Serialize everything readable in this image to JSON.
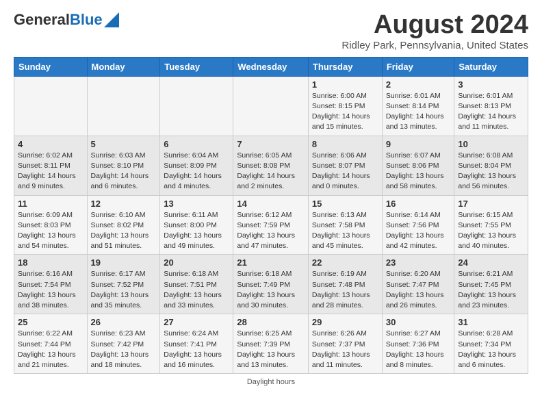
{
  "header": {
    "logo_line1": "General",
    "logo_line2": "Blue",
    "main_title": "August 2024",
    "sub_title": "Ridley Park, Pennsylvania, United States"
  },
  "days_of_week": [
    "Sunday",
    "Monday",
    "Tuesday",
    "Wednesday",
    "Thursday",
    "Friday",
    "Saturday"
  ],
  "weeks": [
    [
      {
        "day": "",
        "info": ""
      },
      {
        "day": "",
        "info": ""
      },
      {
        "day": "",
        "info": ""
      },
      {
        "day": "",
        "info": ""
      },
      {
        "day": "1",
        "info": "Sunrise: 6:00 AM\nSunset: 8:15 PM\nDaylight: 14 hours\nand 15 minutes."
      },
      {
        "day": "2",
        "info": "Sunrise: 6:01 AM\nSunset: 8:14 PM\nDaylight: 14 hours\nand 13 minutes."
      },
      {
        "day": "3",
        "info": "Sunrise: 6:01 AM\nSunset: 8:13 PM\nDaylight: 14 hours\nand 11 minutes."
      }
    ],
    [
      {
        "day": "4",
        "info": "Sunrise: 6:02 AM\nSunset: 8:11 PM\nDaylight: 14 hours\nand 9 minutes."
      },
      {
        "day": "5",
        "info": "Sunrise: 6:03 AM\nSunset: 8:10 PM\nDaylight: 14 hours\nand 6 minutes."
      },
      {
        "day": "6",
        "info": "Sunrise: 6:04 AM\nSunset: 8:09 PM\nDaylight: 14 hours\nand 4 minutes."
      },
      {
        "day": "7",
        "info": "Sunrise: 6:05 AM\nSunset: 8:08 PM\nDaylight: 14 hours\nand 2 minutes."
      },
      {
        "day": "8",
        "info": "Sunrise: 6:06 AM\nSunset: 8:07 PM\nDaylight: 14 hours\nand 0 minutes."
      },
      {
        "day": "9",
        "info": "Sunrise: 6:07 AM\nSunset: 8:06 PM\nDaylight: 13 hours\nand 58 minutes."
      },
      {
        "day": "10",
        "info": "Sunrise: 6:08 AM\nSunset: 8:04 PM\nDaylight: 13 hours\nand 56 minutes."
      }
    ],
    [
      {
        "day": "11",
        "info": "Sunrise: 6:09 AM\nSunset: 8:03 PM\nDaylight: 13 hours\nand 54 minutes."
      },
      {
        "day": "12",
        "info": "Sunrise: 6:10 AM\nSunset: 8:02 PM\nDaylight: 13 hours\nand 51 minutes."
      },
      {
        "day": "13",
        "info": "Sunrise: 6:11 AM\nSunset: 8:00 PM\nDaylight: 13 hours\nand 49 minutes."
      },
      {
        "day": "14",
        "info": "Sunrise: 6:12 AM\nSunset: 7:59 PM\nDaylight: 13 hours\nand 47 minutes."
      },
      {
        "day": "15",
        "info": "Sunrise: 6:13 AM\nSunset: 7:58 PM\nDaylight: 13 hours\nand 45 minutes."
      },
      {
        "day": "16",
        "info": "Sunrise: 6:14 AM\nSunset: 7:56 PM\nDaylight: 13 hours\nand 42 minutes."
      },
      {
        "day": "17",
        "info": "Sunrise: 6:15 AM\nSunset: 7:55 PM\nDaylight: 13 hours\nand 40 minutes."
      }
    ],
    [
      {
        "day": "18",
        "info": "Sunrise: 6:16 AM\nSunset: 7:54 PM\nDaylight: 13 hours\nand 38 minutes."
      },
      {
        "day": "19",
        "info": "Sunrise: 6:17 AM\nSunset: 7:52 PM\nDaylight: 13 hours\nand 35 minutes."
      },
      {
        "day": "20",
        "info": "Sunrise: 6:18 AM\nSunset: 7:51 PM\nDaylight: 13 hours\nand 33 minutes."
      },
      {
        "day": "21",
        "info": "Sunrise: 6:18 AM\nSunset: 7:49 PM\nDaylight: 13 hours\nand 30 minutes."
      },
      {
        "day": "22",
        "info": "Sunrise: 6:19 AM\nSunset: 7:48 PM\nDaylight: 13 hours\nand 28 minutes."
      },
      {
        "day": "23",
        "info": "Sunrise: 6:20 AM\nSunset: 7:47 PM\nDaylight: 13 hours\nand 26 minutes."
      },
      {
        "day": "24",
        "info": "Sunrise: 6:21 AM\nSunset: 7:45 PM\nDaylight: 13 hours\nand 23 minutes."
      }
    ],
    [
      {
        "day": "25",
        "info": "Sunrise: 6:22 AM\nSunset: 7:44 PM\nDaylight: 13 hours\nand 21 minutes."
      },
      {
        "day": "26",
        "info": "Sunrise: 6:23 AM\nSunset: 7:42 PM\nDaylight: 13 hours\nand 18 minutes."
      },
      {
        "day": "27",
        "info": "Sunrise: 6:24 AM\nSunset: 7:41 PM\nDaylight: 13 hours\nand 16 minutes."
      },
      {
        "day": "28",
        "info": "Sunrise: 6:25 AM\nSunset: 7:39 PM\nDaylight: 13 hours\nand 13 minutes."
      },
      {
        "day": "29",
        "info": "Sunrise: 6:26 AM\nSunset: 7:37 PM\nDaylight: 13 hours\nand 11 minutes."
      },
      {
        "day": "30",
        "info": "Sunrise: 6:27 AM\nSunset: 7:36 PM\nDaylight: 13 hours\nand 8 minutes."
      },
      {
        "day": "31",
        "info": "Sunrise: 6:28 AM\nSunset: 7:34 PM\nDaylight: 13 hours\nand 6 minutes."
      }
    ]
  ],
  "footer": "Daylight hours"
}
